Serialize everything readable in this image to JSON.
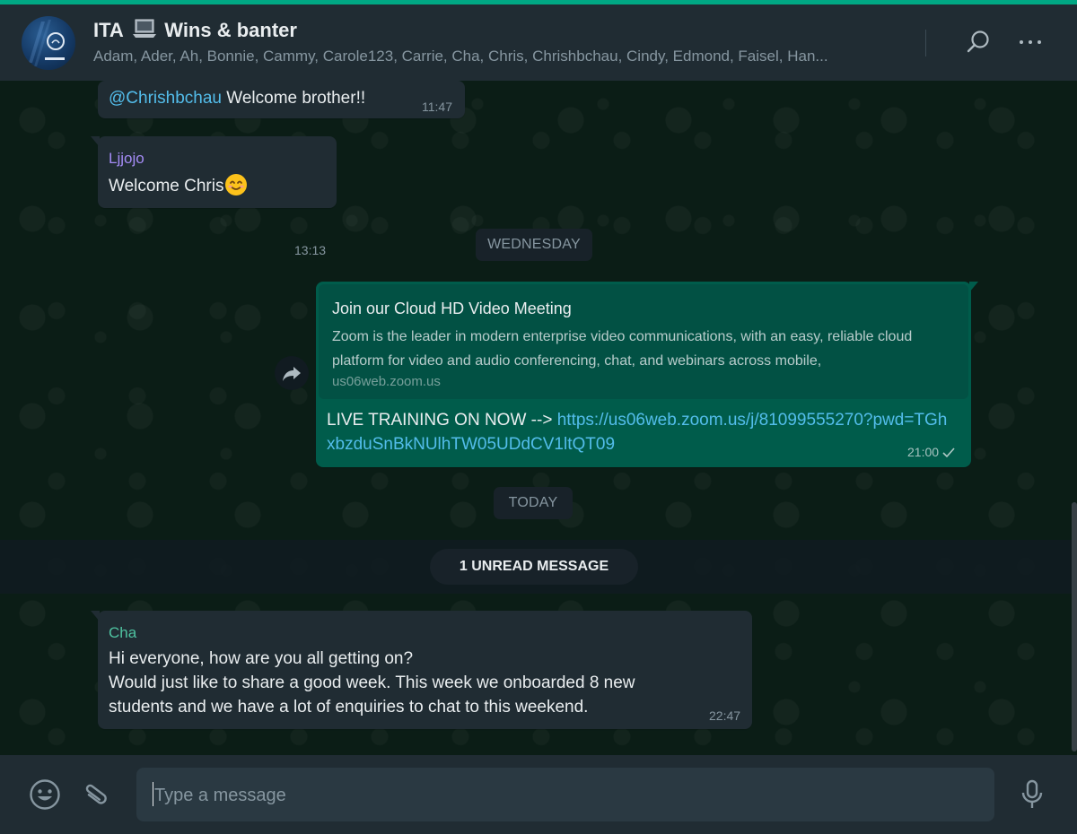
{
  "colors": {
    "accent": "#00a884",
    "header_bg": "#202c33",
    "incoming_bubble": "#202c33",
    "outgoing_bubble": "#005c4b",
    "mention": "#53bdeb",
    "sender_ljjojo": "#a48bf5",
    "sender_cha": "#4fc3a1"
  },
  "header": {
    "title_prefix": "ITA",
    "title_icon": "laptop-icon",
    "title_suffix": "Wins & banter",
    "participants": "Adam, Ader, Ah, Bonnie, Cammy, Carole123, Carrie, Cha, Chris, Chrishbchau, Cindy, Edmond, Faisel, Han...",
    "icons": [
      "search-icon",
      "menu-icon"
    ]
  },
  "messages": [
    {
      "mention": "@Chrishbchau",
      "text": " Welcome brother!!",
      "time": "11:47"
    },
    {
      "sender": "Ljjojo",
      "text": "Welcome Chris",
      "emoji": "smiling-face-icon",
      "time": "13:13"
    },
    {
      "day": "WEDNESDAY"
    },
    {
      "preview_title": "Join our Cloud HD Video Meeting",
      "preview_desc": "Zoom is the leader in modern enterprise video communications, with an easy, reliable cloud platform for video and audio conferencing, chat, and webinars across mobile,",
      "preview_domain": "us06web.zoom.us",
      "text": "LIVE TRAINING ON NOW --> ",
      "link": "https://us06web.zoom.us/j/81099555270?pwd=TGhxbzduSnBkNUlhTW05UDdCV1ltQT09",
      "time": "21:00"
    },
    {
      "day": "TODAY"
    },
    {
      "unread": "1 UNREAD MESSAGE"
    },
    {
      "sender": "Cha",
      "lines": [
        "Hi everyone, how are you all getting on?",
        "Would just like to share a good week. This week we onboarded 8 new students and we have a lot of enquiries to chat to this weekend."
      ],
      "time": "22:47"
    }
  ],
  "footer": {
    "placeholder": "Type a message",
    "icons": [
      "emoji-icon",
      "paperclip-icon",
      "microphone-icon"
    ]
  }
}
